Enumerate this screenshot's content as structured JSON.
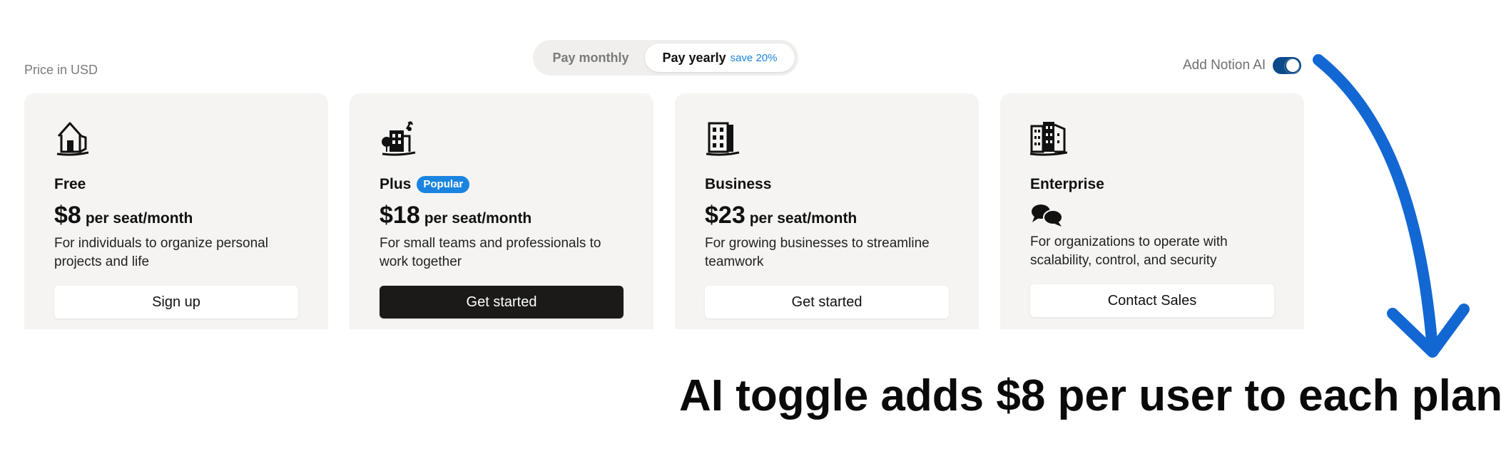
{
  "price_note": "Price in USD",
  "billing": {
    "monthly_label": "Pay monthly",
    "yearly_label": "Pay yearly",
    "yearly_save": "save 20%",
    "selected": "yearly"
  },
  "ai_addon": {
    "label": "Add Notion AI",
    "enabled": true
  },
  "plans": [
    {
      "name": "Free",
      "badge": "",
      "price": "$8",
      "unit": "per seat/month",
      "description": "For individuals to organize personal projects and life",
      "cta": "Sign up",
      "icon": "house-icon"
    },
    {
      "name": "Plus",
      "badge": "Popular",
      "price": "$18",
      "unit": "per seat/month",
      "description": "For small teams and professionals to work together",
      "cta": "Get started",
      "icon": "small-building-icon"
    },
    {
      "name": "Business",
      "badge": "",
      "price": "$23",
      "unit": "per seat/month",
      "description": "For growing businesses to streamline teamwork",
      "cta": "Get started",
      "icon": "office-building-icon"
    },
    {
      "name": "Enterprise",
      "badge": "",
      "price": "",
      "unit": "",
      "description": "For organizations to operate with scalability, control, and security",
      "cta": "Contact Sales",
      "icon": "city-buildings-icon"
    }
  ],
  "annotation": {
    "text": "AI toggle adds $8 per user to each plan"
  },
  "colors": {
    "accent": "#1a84e0",
    "card_bg": "#f5f4f2",
    "dark_button": "#1b1a19",
    "toggle_on": "#0c4a8a"
  }
}
